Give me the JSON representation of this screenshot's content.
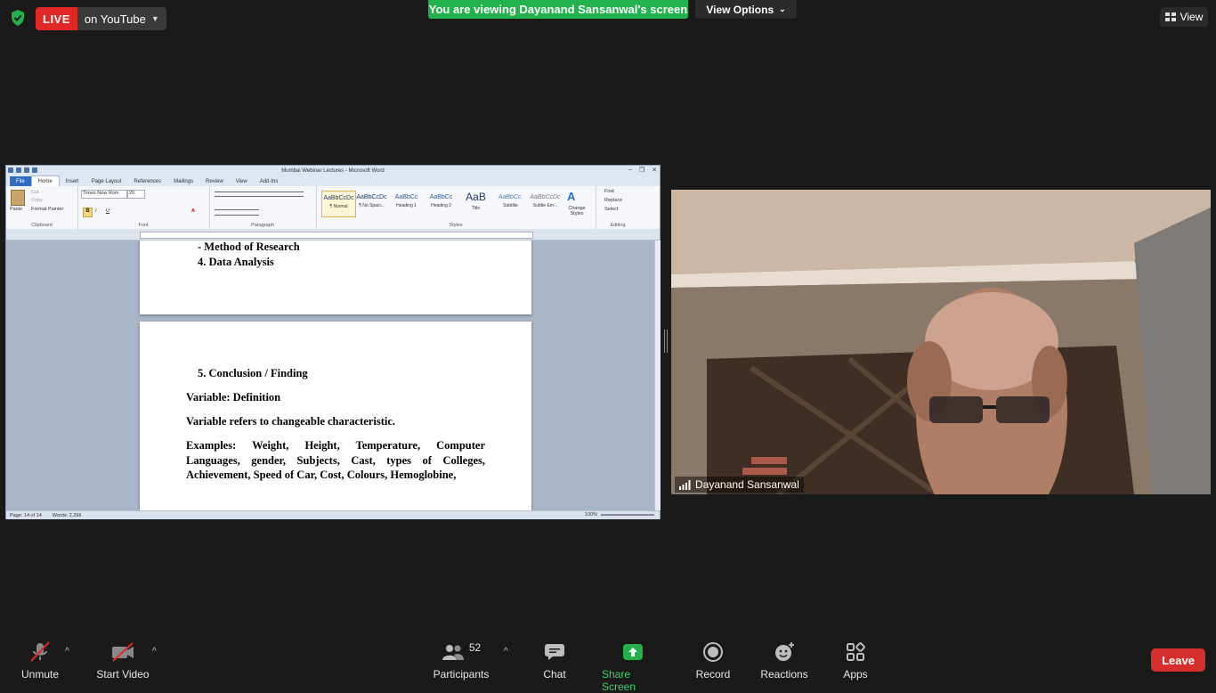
{
  "topbar": {
    "live_badge": "LIVE",
    "live_target": "on YouTube",
    "viewing_banner": "You are viewing Dayanand Sansanwal's screen",
    "view_options": "View Options",
    "view": "View"
  },
  "word": {
    "window_title": "Mumbai Webinar Lectures - Microsoft Word",
    "tabs": [
      "File",
      "Home",
      "Insert",
      "Page Layout",
      "References",
      "Mailings",
      "Review",
      "View",
      "Add-Ins"
    ],
    "active_tab": "Home",
    "clipboard": {
      "paste": "Paste",
      "cut": "Cut",
      "copy": "Copy",
      "format_painter": "Format Painter",
      "label": "Clipboard"
    },
    "font": {
      "name": "Times New Rom",
      "size": "20",
      "label": "Font"
    },
    "paragraph_label": "Paragraph",
    "styles": [
      {
        "sample": "AaBbCcDc",
        "name": "¶ Normal"
      },
      {
        "sample": "AaBbCcDc",
        "name": "¶ No Spaci..."
      },
      {
        "sample": "AaBbCc",
        "name": "Heading 1"
      },
      {
        "sample": "AaBbCc",
        "name": "Heading 2"
      },
      {
        "sample": "AaB",
        "name": "Title"
      },
      {
        "sample": "AaBbCc.",
        "name": "Subtitle"
      },
      {
        "sample": "AaBbCcDc",
        "name": "Subtle Em..."
      }
    ],
    "styles_label": "Styles",
    "change_styles": "Change Styles",
    "editing": {
      "find": "Find",
      "replace": "Replace",
      "select": "Select",
      "label": "Editing"
    },
    "document": {
      "line1": "-  Method of Research",
      "line2": "4. Data Analysis",
      "line3": "5. Conclusion / Finding",
      "line4": "Variable: Definition",
      "line5": "Variable refers to changeable characteristic.",
      "para": "Examples: Weight, Height, Temperature, Computer Languages, gender, Subjects, Cast, types of Colleges, Achievement, Speed of Car, Cost, Colours, Hemoglobine,"
    },
    "status": {
      "page": "Page: 14 of 14",
      "words": "Words: 2,296",
      "zoom": "100%"
    }
  },
  "video": {
    "participant_name": "Dayanand Sansanwal"
  },
  "toolbar": {
    "unmute": "Unmute",
    "start_video": "Start Video",
    "participants": "Participants",
    "participants_count": "52",
    "chat": "Chat",
    "share_screen": "Share Screen",
    "record": "Record",
    "reactions": "Reactions",
    "apps": "Apps",
    "leave": "Leave"
  },
  "colors": {
    "live_red": "#e02828",
    "share_green": "#23b14d",
    "leave_red": "#d62d2d",
    "background": "#1a1a1a"
  }
}
